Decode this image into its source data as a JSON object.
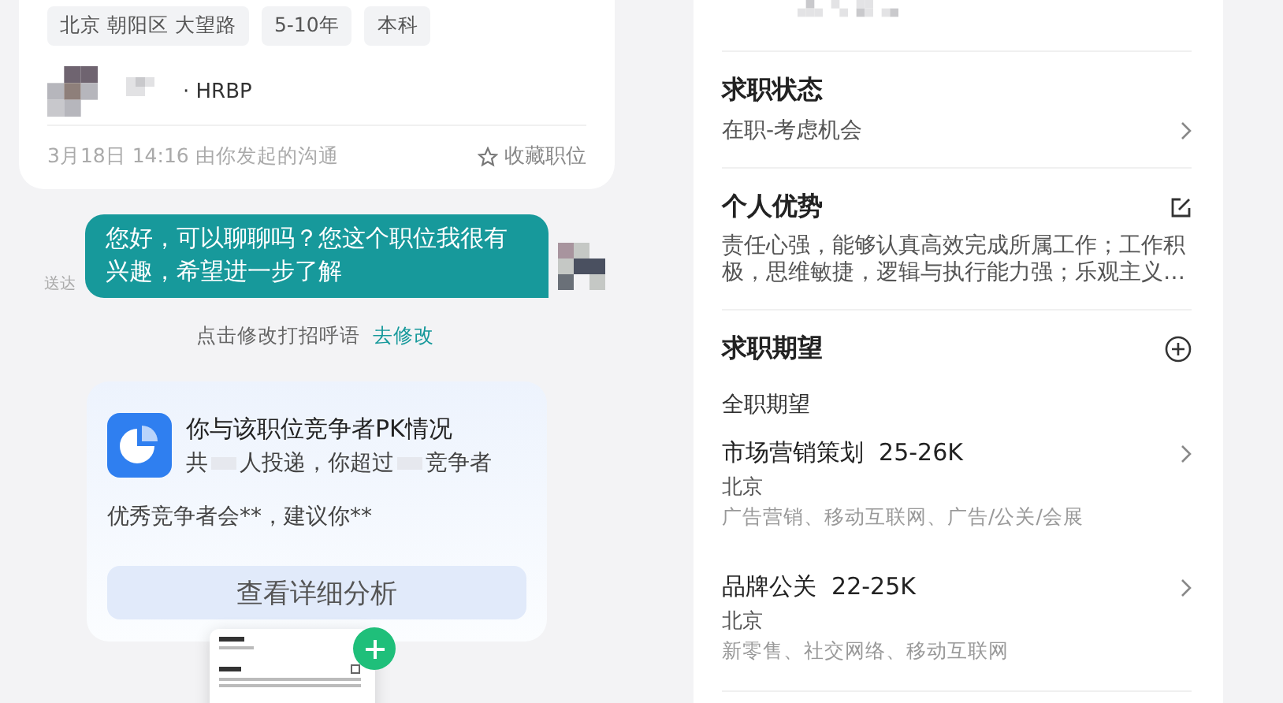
{
  "chat": {
    "job_card": {
      "tags": [
        "北京 朝阳区 大望路",
        "5-10年",
        "本科"
      ],
      "recruiter_role": "· HRBP",
      "timestamp": "3月18日 14:16 由你发起的沟通",
      "favorite_label": "收藏职位",
      "favorited": false
    },
    "message": {
      "text": "您好，可以聊聊吗？您这个职位我很有兴趣，希望进一步了解",
      "status": "送达"
    },
    "greeting_hint": {
      "text": "点击修改打招呼语",
      "link": "去修改"
    },
    "pk_card": {
      "title": "你与该职位竞争者PK情况",
      "summary_parts": [
        "共",
        "人投递，你超过",
        "竞争者"
      ],
      "advice": "优秀竞争者会**，建议你**",
      "button": "查看详细分析"
    }
  },
  "profile": {
    "job_status": {
      "title": "求职状态",
      "value": "在职-考虑机会"
    },
    "advantages": {
      "title": "个人优势",
      "text": "责任心强，能够认真高效完成所属工作；工作积极，思维敏捷，逻辑与执行能力强；乐观主义…"
    },
    "expectations": {
      "title": "求职期望",
      "subtitle": "全职期望",
      "items": [
        {
          "title": "市场营销策划",
          "salary": "25-26K",
          "city": "北京",
          "industries": "广告营销、移动互联网、广告/公关/会展"
        },
        {
          "title": "品牌公关",
          "salary": "22-25K",
          "city": "北京",
          "industries": "新零售、社交网络、移动互联网"
        }
      ]
    }
  }
}
